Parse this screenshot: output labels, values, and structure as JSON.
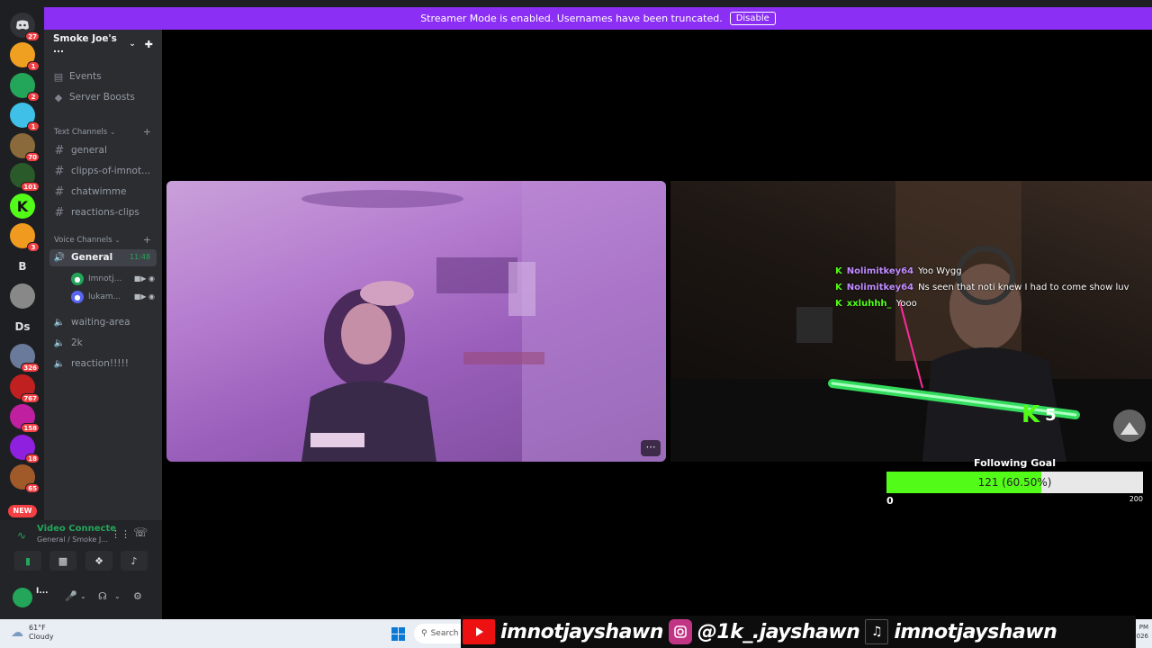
{
  "banner": {
    "message": "Streamer Mode is enabled. Usernames have been truncated.",
    "button_label": "Disable"
  },
  "rail": {
    "home_badge": "27",
    "servers": [
      {
        "badge": "1",
        "color": "#f0a020"
      },
      {
        "badge": "2",
        "color": "#23a55a"
      },
      {
        "badge": "1",
        "color": "#3ec0e8"
      },
      {
        "badge": "70",
        "color": "#8a6a3a"
      },
      {
        "badge": "101",
        "color": "#2a5a2a"
      },
      {
        "badge": "",
        "color": "#53fc18",
        "letter": "K"
      },
      {
        "badge": "3",
        "color": "#f09a20"
      },
      {
        "badge": "",
        "color": "#1e1f22",
        "letter": "B"
      },
      {
        "badge": "",
        "color": "#888888"
      },
      {
        "badge": "",
        "color": "#1e1f22",
        "letter": "Ds"
      },
      {
        "badge": "326",
        "color": "#6a7a9a"
      },
      {
        "badge": "767",
        "color": "#c02020"
      },
      {
        "badge": "158",
        "color": "#c020a0"
      },
      {
        "badge": "18",
        "color": "#9020e0"
      },
      {
        "badge": "65",
        "color": "#a05a2a"
      }
    ],
    "new_label": "NEW"
  },
  "sidebar": {
    "server_name": "Smoke Joe's ...",
    "nav": [
      {
        "label": "Events",
        "icon": "calendar-icon"
      },
      {
        "label": "Server Boosts",
        "icon": "boost-icon"
      }
    ],
    "text_category": "Text Channels",
    "text_channels": [
      "general",
      "clipps-of-imnot...",
      "chatwimme",
      "reactions-clips"
    ],
    "voice_category": "Voice Channels",
    "active_voice": {
      "name": "General",
      "time": "11:48"
    },
    "voice_users": [
      "Imnotj...",
      "lukam..."
    ],
    "voice_channels": [
      "waiting-area",
      "2k",
      "reaction!!!!!"
    ]
  },
  "bottom": {
    "vc_title": "Video Connecte",
    "vc_sub": "General / Smoke J...",
    "user_name": "I..."
  },
  "stream": {
    "chat": [
      {
        "user": "Nolimitkey64",
        "message": "Yoo Wygg"
      },
      {
        "user": "Nolimitkey64",
        "message": "Ns seen that noti knew I had to come show luv"
      },
      {
        "user": "xxluhhh_",
        "message": "Yooo"
      }
    ],
    "kick_count": "5",
    "goal": {
      "title": "Following Goal",
      "label": "121 (60.50%)",
      "progress": 0.605,
      "min": "0",
      "max": "200"
    }
  },
  "taskbar": {
    "weather_temp": "61°F",
    "weather_desc": "Cloudy",
    "search": "Search",
    "clock_top": "PM",
    "clock_bottom": "026"
  },
  "socials": {
    "youtube": "imnotjayshawn",
    "instagram": "@1k_.jayshawn",
    "tiktok": "imnotjayshawn"
  }
}
